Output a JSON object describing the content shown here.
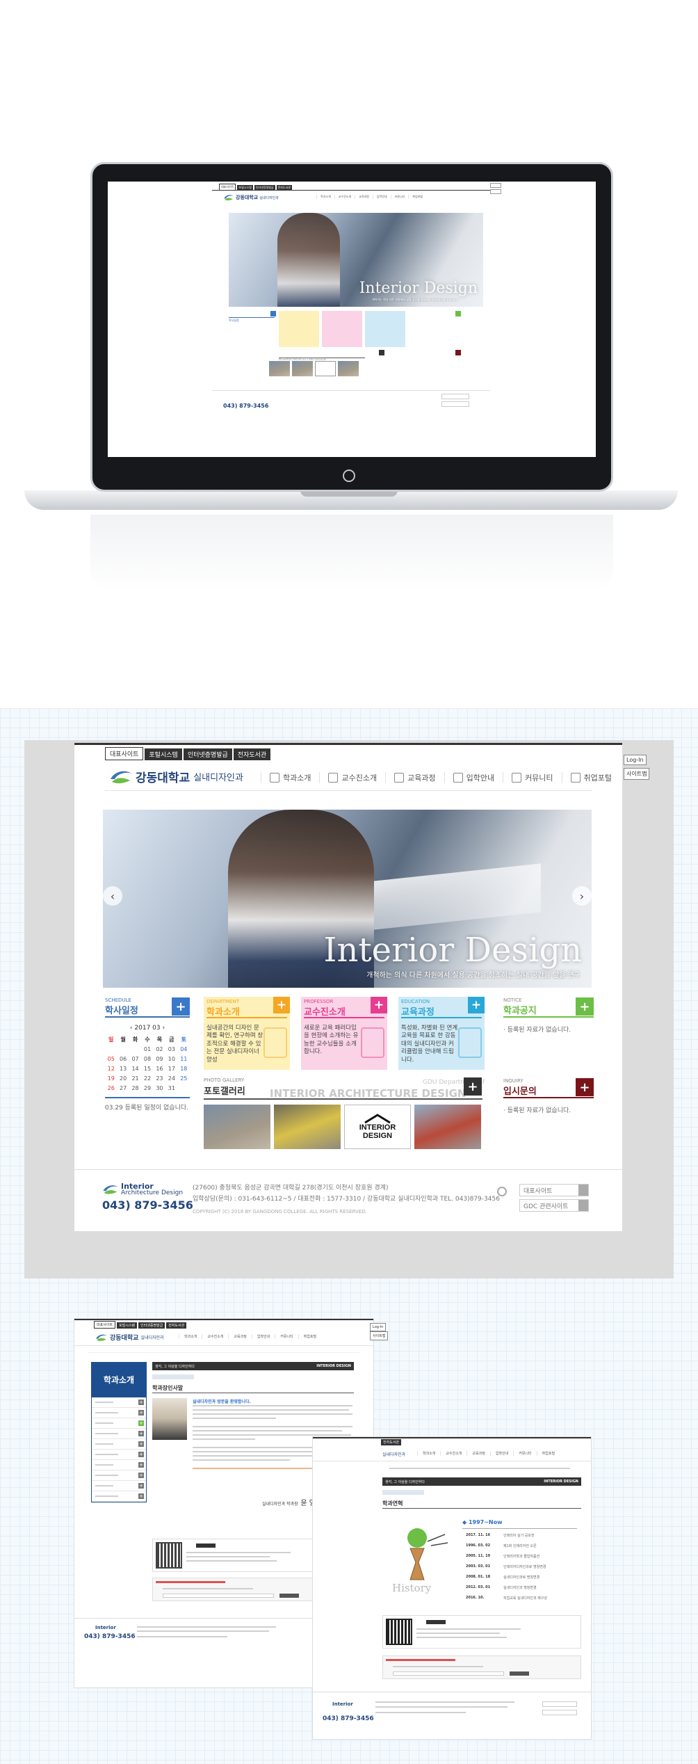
{
  "site": {
    "top_links": [
      "대표사이트",
      "포털시스템",
      "인터넷증명발급",
      "전자도서관"
    ],
    "logo_name": "강동대학교",
    "logo_dept": "실내디자인과",
    "login": "Log-In",
    "sitemap": "사이트맵",
    "nav": [
      "학과소개",
      "교수진소개",
      "교육과정",
      "입학안내",
      "커뮤니티",
      "취업포털"
    ]
  },
  "hero": {
    "title": "Interior Design",
    "subtitle": "개척하는 의식 다른 차원에서 실용 공간을 창조하는 실내 공간을 앞을 연구"
  },
  "schedule": {
    "eng": "SCHEDULE",
    "title": "학사일정",
    "month": "2017 03",
    "weekdays": [
      "일",
      "월",
      "화",
      "수",
      "목",
      "금",
      "토"
    ],
    "days": [
      "",
      "",
      "",
      "01",
      "02",
      "03",
      "04",
      "05",
      "06",
      "07",
      "08",
      "09",
      "10",
      "11",
      "12",
      "13",
      "14",
      "15",
      "16",
      "17",
      "18",
      "19",
      "20",
      "21",
      "22",
      "23",
      "24",
      "25",
      "26",
      "27",
      "28",
      "29",
      "30",
      "31",
      ""
    ],
    "note": "03.29 등록된 일정이 없습니다."
  },
  "cards": [
    {
      "eng": "DEPARTMENT",
      "title": "학과소개",
      "desc": "실내공간의 디자인 문제를 확인, 연구하며 창조적으로 해결할 수 있는 전문 실내디자이너 양성",
      "color": "#f5a623",
      "bg": "#fdf1b9"
    },
    {
      "eng": "PROFESSOR",
      "title": "교수진소개",
      "desc": "새로운 교육 패러다임을 현장에 소개하는 유능한 교수님들을 소개합니다.",
      "color": "#e53d8f",
      "bg": "#fbd3e6"
    },
    {
      "eng": "EDUCATION",
      "title": "교육과정",
      "desc": "특성화, 차별화 된 연계교육을 목표로 한 강동대의 실내디자인과 커리큘럼을 안내해 드립니다.",
      "color": "#2aa7d9",
      "bg": "#cfeaf6"
    }
  ],
  "notice": {
    "eng": "NOTICE",
    "title": "학과공지",
    "empty": "등록된 자료가 없습니다.",
    "color": "#6cbe45"
  },
  "inquiry": {
    "eng": "INQUIRY",
    "title": "입시문의",
    "empty": "등록된 자료가 없습니다.",
    "color": "#7a1419"
  },
  "gallery": {
    "eng": "PHOTO GALLERY",
    "title": "포토갤러리",
    "watermark": "INTERIOR ARCHITECTURE DESIGN",
    "gdu": "GDU Department of"
  },
  "footer": {
    "logo_en1": "Interior",
    "logo_en2": "Architecture Design",
    "phone": "043) 879-3456",
    "address": "(27600) 충청북도 음성군 감곡면 대학길 278(경기도 이천시 장호원 경계)",
    "contact": "입학상담(문의) : 031-643-6112~5 / 대표전화 : 1577-3310 / 강동대학교 실내디자인학과 TEL. 043)879-3456",
    "copyright": "COPYRIGHT (C) 2018 BY GANGDONG COLLEGE. ALL RIGHTS RESERVED.",
    "select1": "대표사이트",
    "select2": "GDC 관련사이트"
  },
  "sub1": {
    "lnb_title": "학과소개",
    "crumb_slogan": "생각, 그 이상을 디자인하다",
    "brand": "INTERIOR DESIGN",
    "page_title": "학과장인사말",
    "greeting_head": "실내디자인과 방문을 환영합니다.",
    "signature": "실내디자인과 학과장",
    "signature_name": "윤 영 식"
  },
  "sub2": {
    "crumb_slogan": "생각, 그 이상을 디자인하다",
    "brand": "INTERIOR DESIGN",
    "page_title": "학과연혁",
    "era": "1997~Now",
    "history_word": "History",
    "timeline": [
      {
        "date": "2017. 11. 16",
        "text": "인테리어 실기 공모전"
      },
      {
        "date": "1996. 03. 02",
        "text": "제1회 인테리어전 오픈"
      },
      {
        "date": "2005. 11. 19",
        "text": "인테리어학과 졸업작품전"
      },
      {
        "date": "2003. 03. 01",
        "text": "인테리어디자인과로 명칭변경"
      },
      {
        "date": "2008. 01. 18",
        "text": "실내디자인과로 명칭변경"
      },
      {
        "date": "2012. 03. 01",
        "text": "실내디자인과 명칭변경"
      },
      {
        "date": "2016. 10.",
        "text": "직업교육 실내디자인과 재구성"
      }
    ]
  }
}
